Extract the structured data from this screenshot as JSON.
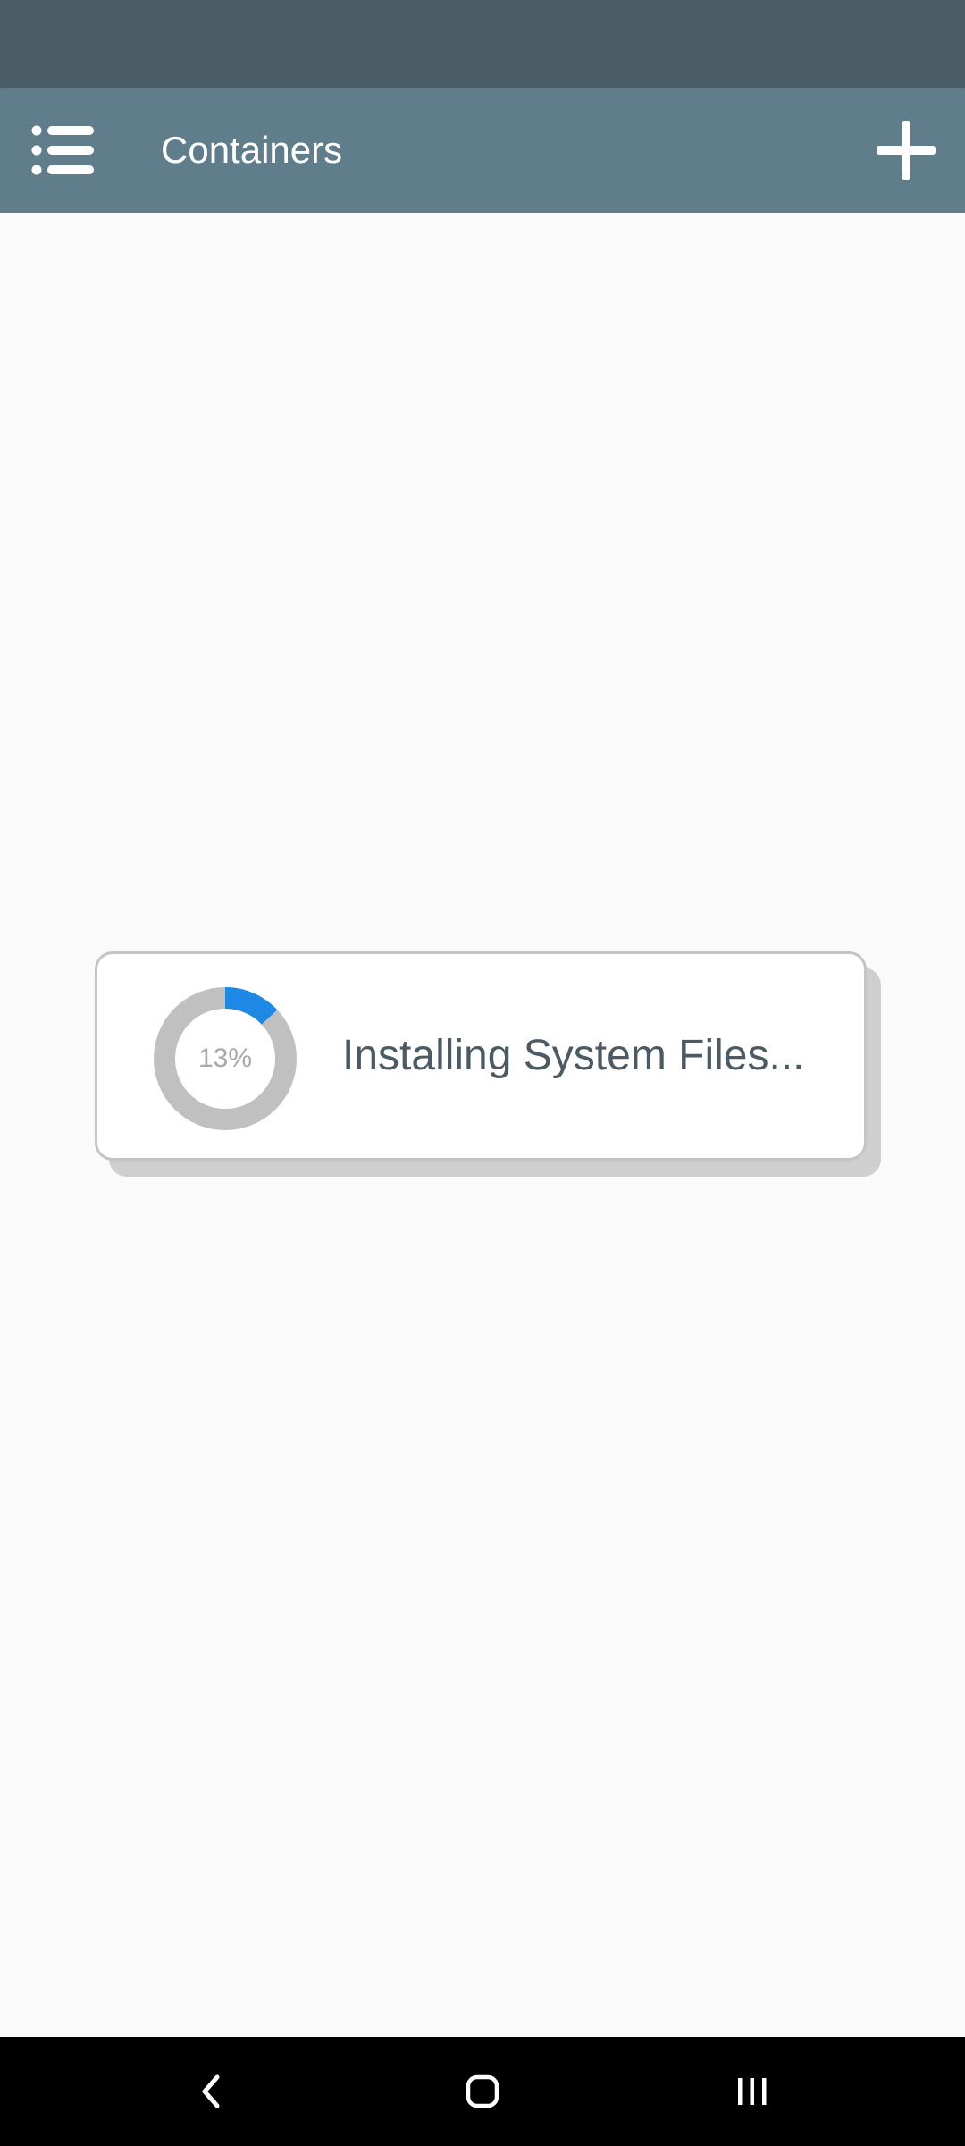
{
  "app_bar": {
    "title": "Containers",
    "menu_icon": "list-menu-icon",
    "add_icon": "plus-icon",
    "color": "#607d8b"
  },
  "status_bar": {
    "color": "#4a5d66"
  },
  "dialog": {
    "message": "Installing System Files...",
    "progress": {
      "value": 13,
      "label": "13%",
      "track_color": "#c0c0c0",
      "fill_color": "#1e88e5"
    }
  },
  "nav_bar": {
    "back_icon": "back-chevron-icon",
    "home_icon": "home-icon",
    "recents_icon": "recents-icon"
  }
}
